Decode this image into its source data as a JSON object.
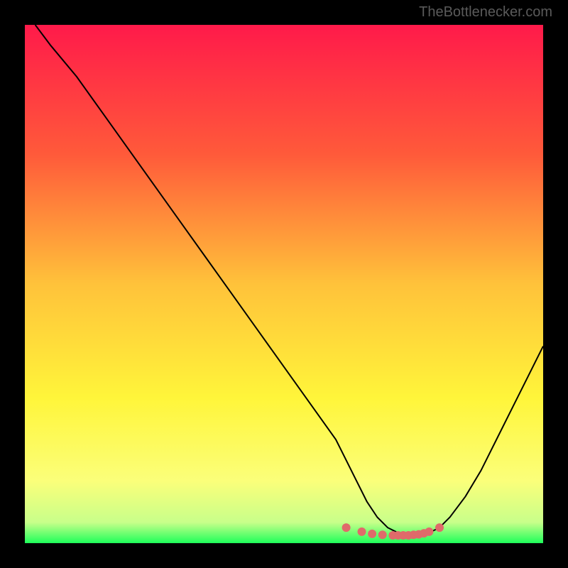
{
  "watermark": "TheBottlenecker.com",
  "chart_data": {
    "type": "line",
    "title": "",
    "xlabel": "",
    "ylabel": "",
    "xlim": [
      0,
      100
    ],
    "ylim": [
      0,
      100
    ],
    "gradient": {
      "stops": [
        {
          "offset": 0,
          "color": "#ff1a4a"
        },
        {
          "offset": 25,
          "color": "#ff5a3a"
        },
        {
          "offset": 50,
          "color": "#ffc23a"
        },
        {
          "offset": 72,
          "color": "#fff53a"
        },
        {
          "offset": 88,
          "color": "#fbff7a"
        },
        {
          "offset": 96,
          "color": "#c8ff8a"
        },
        {
          "offset": 100,
          "color": "#1eff5a"
        }
      ]
    },
    "series": [
      {
        "name": "bottleneck-curve",
        "color": "#000000",
        "stroke_width": 2,
        "x": [
          2,
          5,
          10,
          15,
          20,
          25,
          30,
          35,
          40,
          45,
          50,
          55,
          60,
          62,
          64,
          66,
          68,
          70,
          72,
          74,
          76,
          78,
          80,
          82,
          85,
          88,
          91,
          94,
          97,
          100
        ],
        "y": [
          100,
          96,
          90,
          83,
          76,
          69,
          62,
          55,
          48,
          41,
          34,
          27,
          20,
          16,
          12,
          8,
          5,
          3,
          2,
          1.5,
          1.5,
          2,
          3,
          5,
          9,
          14,
          20,
          26,
          32,
          38
        ]
      },
      {
        "name": "marker-band",
        "type": "scatter",
        "color": "#e06a6a",
        "x": [
          62,
          65,
          67,
          69,
          71,
          72,
          73,
          74,
          75,
          76,
          77,
          78,
          80
        ],
        "y": [
          3.0,
          2.2,
          1.8,
          1.6,
          1.5,
          1.5,
          1.5,
          1.5,
          1.6,
          1.7,
          1.9,
          2.2,
          3.0
        ]
      }
    ]
  }
}
